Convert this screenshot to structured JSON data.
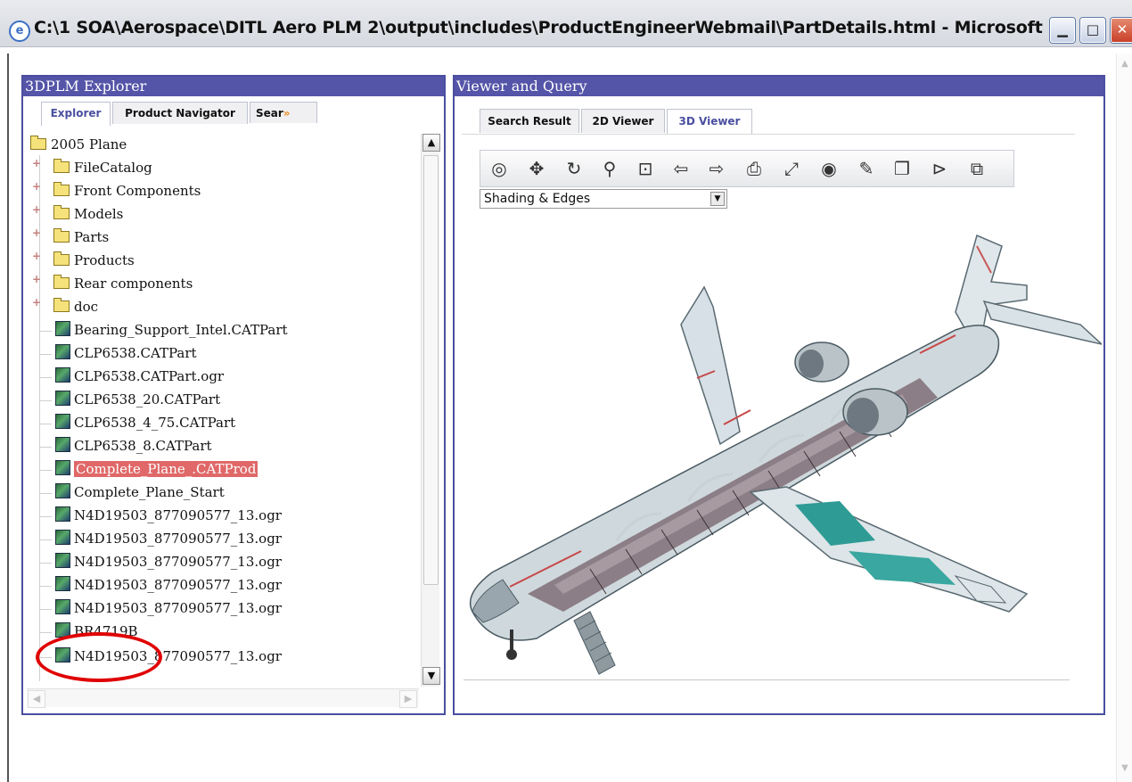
{
  "window": {
    "title": "C:\\1 SOA\\Aerospace\\DITL Aero PLM 2\\output\\includes\\ProductEngineerWebmail\\PartDetails.html - Microsoft I...",
    "min_glyph": "▁",
    "max_glyph": "□",
    "close_glyph": "✕"
  },
  "explorer": {
    "title": "3DPLM Explorer",
    "tabs": [
      {
        "label": "Explorer"
      },
      {
        "label": "Product Navigator"
      },
      {
        "label": "Sear"
      }
    ],
    "tab_more_glyph": "»",
    "tree": {
      "root": "2005 Plane",
      "folders": [
        {
          "label": "FileCatalog"
        },
        {
          "label": "Front Components"
        },
        {
          "label": "Models"
        },
        {
          "label": "Parts"
        },
        {
          "label": "Products"
        },
        {
          "label": "Rear components"
        },
        {
          "label": "doc"
        }
      ],
      "files": [
        {
          "label": "Bearing_Support_Intel.CATPart"
        },
        {
          "label": "CLP6538.CATPart"
        },
        {
          "label": "CLP6538.CATPart.ogr"
        },
        {
          "label": "CLP6538_20.CATPart"
        },
        {
          "label": "CLP6538_4_75.CATPart"
        },
        {
          "label": "CLP6538_8.CATPart"
        },
        {
          "label": "Complete_Plane_.CATProd"
        },
        {
          "label": "Complete_Plane_Start"
        },
        {
          "label": "N4D19503_877090577_13.ogr"
        },
        {
          "label": "N4D19503_877090577_13.ogr"
        },
        {
          "label": "N4D19503_877090577_13.ogr"
        },
        {
          "label": "N4D19503_877090577_13.ogr"
        },
        {
          "label": "N4D19503_877090577_13.ogr"
        },
        {
          "label": "BR4719B"
        },
        {
          "label": "N4D19503_877090577_13.ogr"
        }
      ],
      "selected_item": "Complete_Plane_.CATProd",
      "highlighted_item": "BR4719B"
    },
    "plus_glyph": "+",
    "scroll_up": "▲",
    "scroll_down": "▼",
    "scroll_left": "◀",
    "scroll_right": "▶"
  },
  "viewer": {
    "title": "Viewer and Query",
    "tabs": [
      {
        "label": "Search Result"
      },
      {
        "label": "2D Viewer"
      },
      {
        "label": "3D Viewer"
      }
    ],
    "active_tab": "3D Viewer",
    "toolbar": [
      {
        "icon": "fit-all-icon",
        "glyph": "◎"
      },
      {
        "icon": "pan-icon",
        "glyph": "✥"
      },
      {
        "icon": "rotate-icon",
        "glyph": "↻"
      },
      {
        "icon": "zoom-icon",
        "glyph": "⚲"
      },
      {
        "icon": "zoom-area-icon",
        "glyph": "⊡"
      },
      {
        "icon": "previous-view-icon",
        "glyph": "⇦"
      },
      {
        "icon": "next-view-icon",
        "glyph": "⇨"
      },
      {
        "icon": "print-icon",
        "glyph": "⎙"
      },
      {
        "icon": "measure-icon",
        "glyph": "⤢"
      },
      {
        "icon": "capture-icon",
        "glyph": "◉"
      },
      {
        "icon": "annotate-icon",
        "glyph": "✎"
      },
      {
        "icon": "section-icon",
        "glyph": "❐"
      },
      {
        "icon": "explode-icon",
        "glyph": "⊳"
      },
      {
        "icon": "properties-icon",
        "glyph": "⧉"
      }
    ],
    "render_mode": {
      "selected": "Shading & Edges"
    },
    "dropdown_glyph": "▼",
    "model": {
      "subject": "cutaway business jet 3D model"
    }
  },
  "colors": {
    "panel_header": "#5454a8",
    "selection": "#e06868",
    "annotation": "#e00000"
  }
}
